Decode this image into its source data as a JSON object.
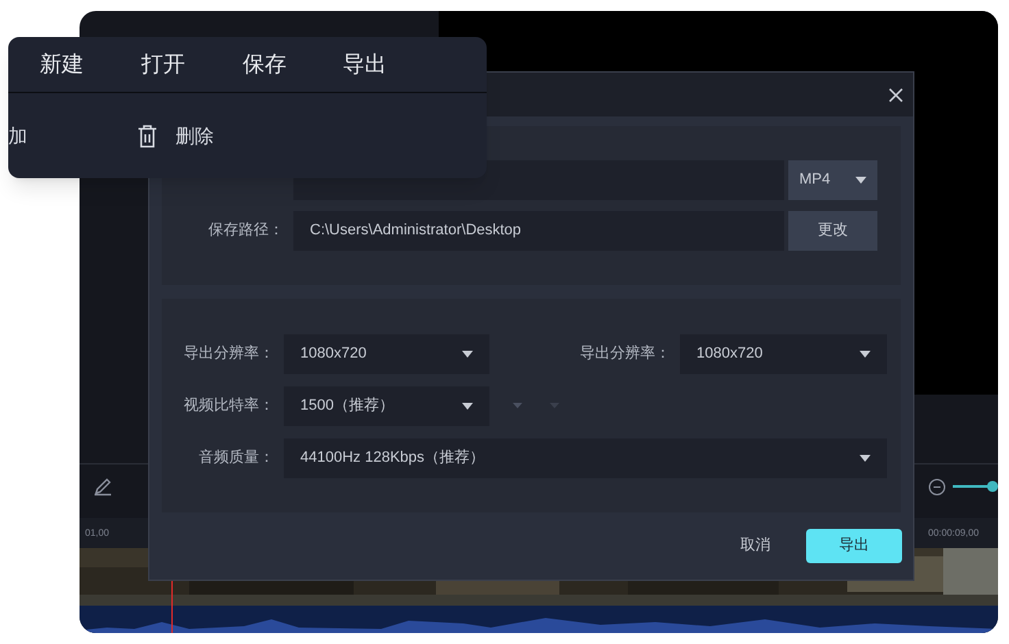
{
  "menu": {
    "top_items": [
      {
        "label": "新建"
      },
      {
        "label": "打开"
      },
      {
        "label": "保存"
      },
      {
        "label": "导出"
      }
    ],
    "actions": [
      {
        "kind": "text",
        "label": "加"
      },
      {
        "kind": "delete",
        "label": "删除"
      }
    ]
  },
  "dialog": {
    "format": "MP4",
    "path_label": "保存路径：",
    "path_value": "C:\\Users\\Administrator\\Desktop",
    "change_button": "更改",
    "settings": [
      {
        "label": "导出分辨率：",
        "value": "1080x720",
        "wide": false
      },
      {
        "label": "导出分辨率：",
        "value": "1080x720",
        "wide": false
      },
      {
        "label": "视频比特率：",
        "value": "1500（推荐）",
        "wide": false
      },
      {
        "label": "音频质量：",
        "value": "44100Hz 128Kbps（推荐）",
        "wide": true
      }
    ],
    "cancel": "取消",
    "confirm": "导出"
  },
  "timeline": {
    "start_time": "01,00",
    "end_time": "00:00:09,00",
    "zoom": {
      "level": 1
    }
  }
}
